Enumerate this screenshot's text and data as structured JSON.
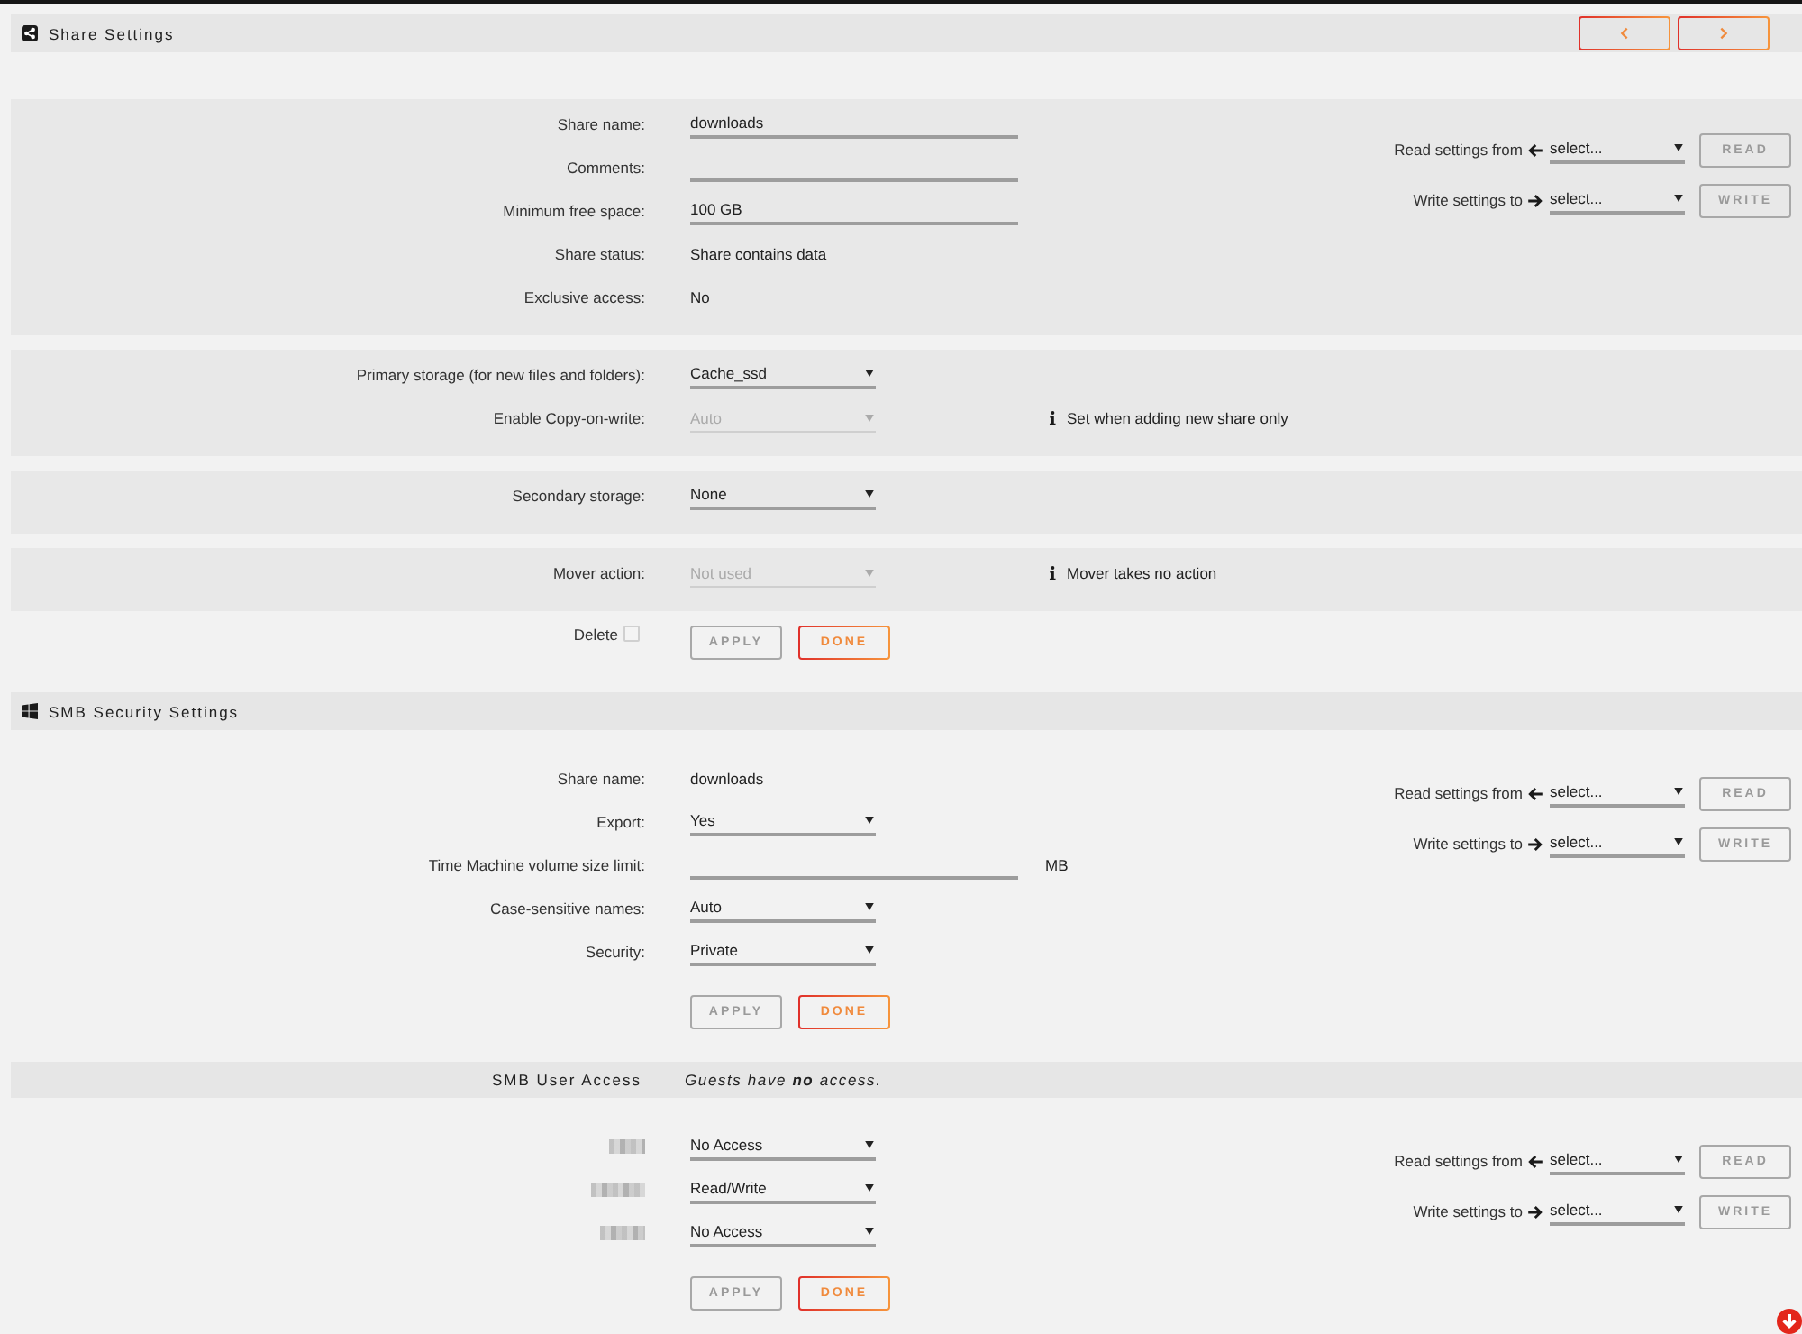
{
  "share_settings": {
    "title": "Share Settings",
    "nav": [
      {
        "kind": "previous"
      },
      {
        "kind": "next"
      }
    ],
    "panels": [
      {
        "rows": [
          {
            "kind": "input",
            "label": "Share name:",
            "value": "downloads",
            "disabled": false
          },
          {
            "kind": "input",
            "label": "Comments:",
            "disabled": false
          },
          {
            "kind": "input",
            "label": "Minimum free space:",
            "value": "100 GB",
            "disabled": false
          },
          {
            "kind": "text",
            "label": "Share status:",
            "value": "Share contains data"
          },
          {
            "kind": "text",
            "label": "Exclusive access:",
            "value": "No"
          }
        ],
        "transfer": [
          {
            "kind": "read",
            "label": "Read settings from",
            "value": "select...",
            "button": "READ",
            "button_disabled": true
          },
          {
            "kind": "write",
            "label": "Write settings to",
            "value": "select...",
            "button": "WRITE",
            "button_disabled": true
          }
        ]
      },
      {
        "rows": [
          {
            "kind": "select",
            "label": "Primary storage (for new files and folders):",
            "value": "Cache_ssd",
            "disabled": false
          },
          {
            "kind": "select",
            "label": "Enable Copy-on-write:",
            "value": "Auto",
            "disabled": true,
            "note": "Set when adding new share only"
          }
        ]
      },
      {
        "rows": [
          {
            "kind": "select",
            "label": "Secondary storage:",
            "value": "None",
            "disabled": false
          }
        ]
      },
      {
        "rows": [
          {
            "kind": "select",
            "label": "Mover action:",
            "value": "Not used",
            "disabled": true,
            "note": "Mover takes no action"
          }
        ]
      }
    ],
    "delete": {
      "label": "Delete",
      "checked": false
    },
    "buttons": [
      {
        "label": "APPLY",
        "disabled": true
      },
      {
        "label": "DONE",
        "disabled": false
      }
    ]
  },
  "smb_security": {
    "title": "SMB Security Settings",
    "rows": [
      {
        "kind": "text",
        "label": "Share name:",
        "value": "downloads"
      },
      {
        "kind": "select",
        "label": "Export:",
        "value": "Yes",
        "disabled": false
      },
      {
        "kind": "input",
        "label": "Time Machine volume size limit:",
        "unit": "MB",
        "disabled": false
      },
      {
        "kind": "select",
        "label": "Case-sensitive names:",
        "value": "Auto",
        "disabled": false
      },
      {
        "kind": "select",
        "label": "Security:",
        "value": "Private",
        "disabled": false
      }
    ],
    "transfer": [
      {
        "kind": "read",
        "label": "Read settings from",
        "value": "select...",
        "button": "READ",
        "button_disabled": true
      },
      {
        "kind": "write",
        "label": "Write settings to",
        "value": "select...",
        "button": "WRITE",
        "button_disabled": true
      }
    ],
    "buttons": [
      {
        "label": "APPLY",
        "disabled": true
      },
      {
        "label": "DONE",
        "disabled": false
      }
    ]
  },
  "smb_user_access": {
    "title": "SMB User Access",
    "note": "Guests have **no** access.",
    "users": [
      {
        "access": "No Access"
      },
      {
        "access": "Read/Write"
      },
      {
        "access": "No Access"
      }
    ],
    "transfer": [
      {
        "kind": "read",
        "label": "Read settings from",
        "value": "select...",
        "button": "READ",
        "button_disabled": true
      },
      {
        "kind": "write",
        "label": "Write settings to",
        "value": "select...",
        "button": "WRITE",
        "button_disabled": true
      }
    ],
    "buttons": [
      {
        "label": "APPLY",
        "disabled": true
      },
      {
        "label": "DONE",
        "disabled": false
      }
    ]
  }
}
